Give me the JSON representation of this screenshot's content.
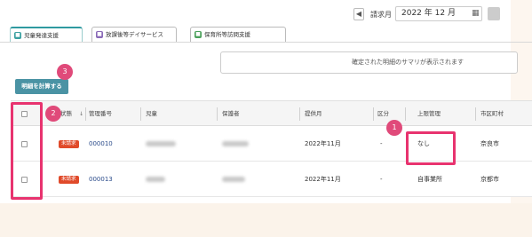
{
  "header": {
    "prev_icon": "◀",
    "month_label": "請求月",
    "month_value": "2022 年 12 月",
    "calendar_icon": "▦"
  },
  "tabs": [
    {
      "label": "児童発達支援",
      "icon_color": "#3aa0a0"
    },
    {
      "label": "放課後等デイサービス",
      "icon_color": "#8a6ab8"
    },
    {
      "label": "保育所等訪問支援",
      "icon_color": "#4aa05a"
    }
  ],
  "summary_text": "確定された明細のサマリが表示されます",
  "batch_button": "明細を計算する",
  "badges": {
    "one": "1",
    "two": "2",
    "three": "3"
  },
  "table": {
    "headers": {
      "status": "状態",
      "sort_arrow": "↓",
      "management_no": "管理番号",
      "child": "児童",
      "guardian": "保護者",
      "service_month": "提供月",
      "category": "区分",
      "cap_management": "上限管理",
      "municipality": "市区町村"
    },
    "rows": [
      {
        "status": "未請求",
        "management_no": "000010",
        "service_month": "2022年11月",
        "category": "-",
        "cap_management": "なし",
        "municipality": "奈良市"
      },
      {
        "status": "未請求",
        "management_no": "000013",
        "service_month": "2022年11月",
        "category": "-",
        "cap_management": "自事業所",
        "municipality": "京都市"
      }
    ]
  },
  "colors": {
    "accent": "#4a93a4",
    "highlight": "#e8336f",
    "status_tag": "#e04a2a"
  }
}
